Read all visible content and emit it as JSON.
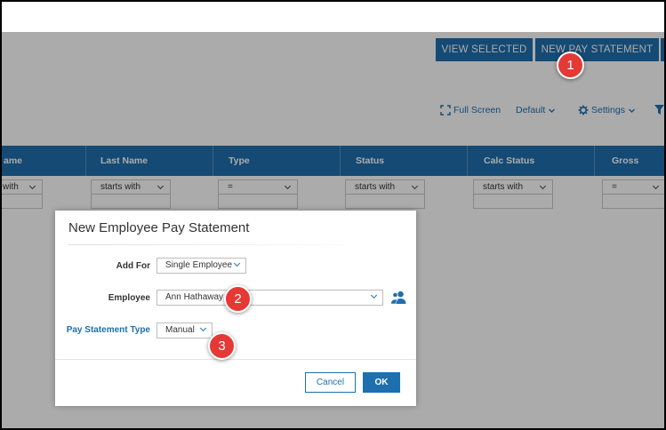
{
  "toolbar": {
    "view_selected": "VIEW SELECTED",
    "new_pay_statement": "NEW PAY STATEMENT",
    "full_screen": "Full Screen",
    "default": "Default",
    "settings": "Settings"
  },
  "grid": {
    "columns": [
      "ame",
      "Last Name",
      "Type",
      "Status",
      "Calc Status",
      "Gross"
    ],
    "filters": [
      "with",
      "starts with",
      "=",
      "starts with",
      "starts with",
      "="
    ]
  },
  "modal": {
    "title": "New Employee Pay Statement",
    "add_for_label": "Add For",
    "add_for_value": "Single Employee",
    "employee_label": "Employee",
    "employee_value": "Ann Hathaway",
    "pay_statement_type_label": "Pay Statement Type",
    "pay_statement_type_value": "Manual",
    "cancel": "Cancel",
    "ok": "OK"
  },
  "badges": [
    "1",
    "2",
    "3"
  ],
  "colors": {
    "accent": "#1e6fae",
    "badge": "#e53935"
  }
}
